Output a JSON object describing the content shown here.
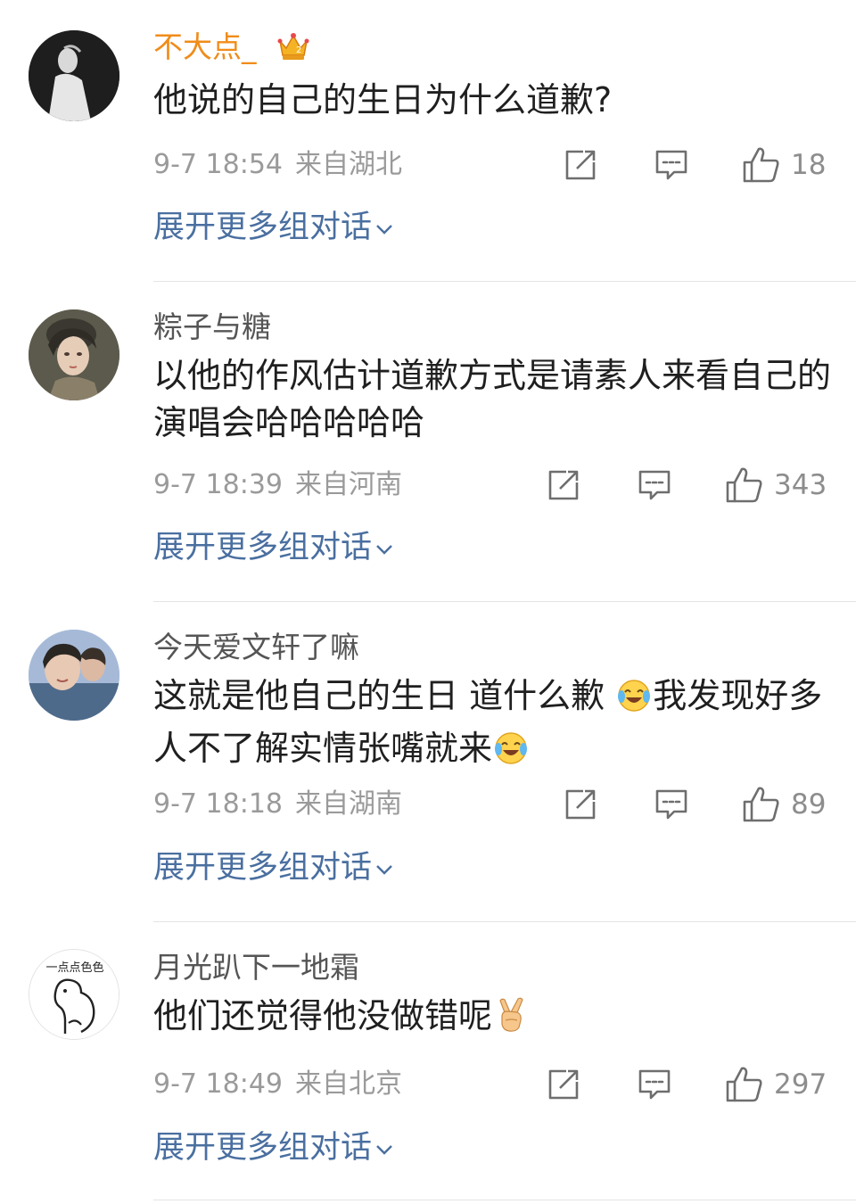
{
  "comments": [
    {
      "username": "不大点_",
      "content": "他说的自己的生日为什么道歉?",
      "time": "9-7 18:54",
      "location": "来自湖北",
      "likes": "18",
      "expand_label": "展开更多组对话"
    },
    {
      "username": "粽子与糖",
      "content": "以他的作风估计道歉方式是请素人来看自己的演唱会哈哈哈哈哈",
      "time": "9-7 18:39",
      "location": "来自河南",
      "likes": "343",
      "expand_label": "展开更多组对话"
    },
    {
      "username": "今天爱文轩了嘛",
      "content_part1": "这就是他自己的生日 道什么歉",
      "content_part2": "我发现好多人不了解实情张嘴就来",
      "time": "9-7 18:18",
      "location": "来自湖南",
      "likes": "89",
      "expand_label": "展开更多组对话"
    },
    {
      "username": "月光趴下一地霜",
      "avatar_text": "一点点色色",
      "content": "他们还觉得他没做错呢",
      "time": "9-7 18:49",
      "location": "来自北京",
      "likes": "297",
      "expand_label": "展开更多组对话"
    }
  ],
  "icons": {
    "share": "share-icon",
    "reply": "comment-icon",
    "like": "thumbs-up-icon",
    "expand": "chevron-down-icon",
    "laugh_cry": "laugh-cry-emoji",
    "victory": "victory-hand-emoji",
    "crown": "vip-crown-icon"
  },
  "colors": {
    "vip_username": "#f08c1a",
    "username": "#555555",
    "link": "#4a6fa0",
    "meta": "#9a9a9a"
  }
}
